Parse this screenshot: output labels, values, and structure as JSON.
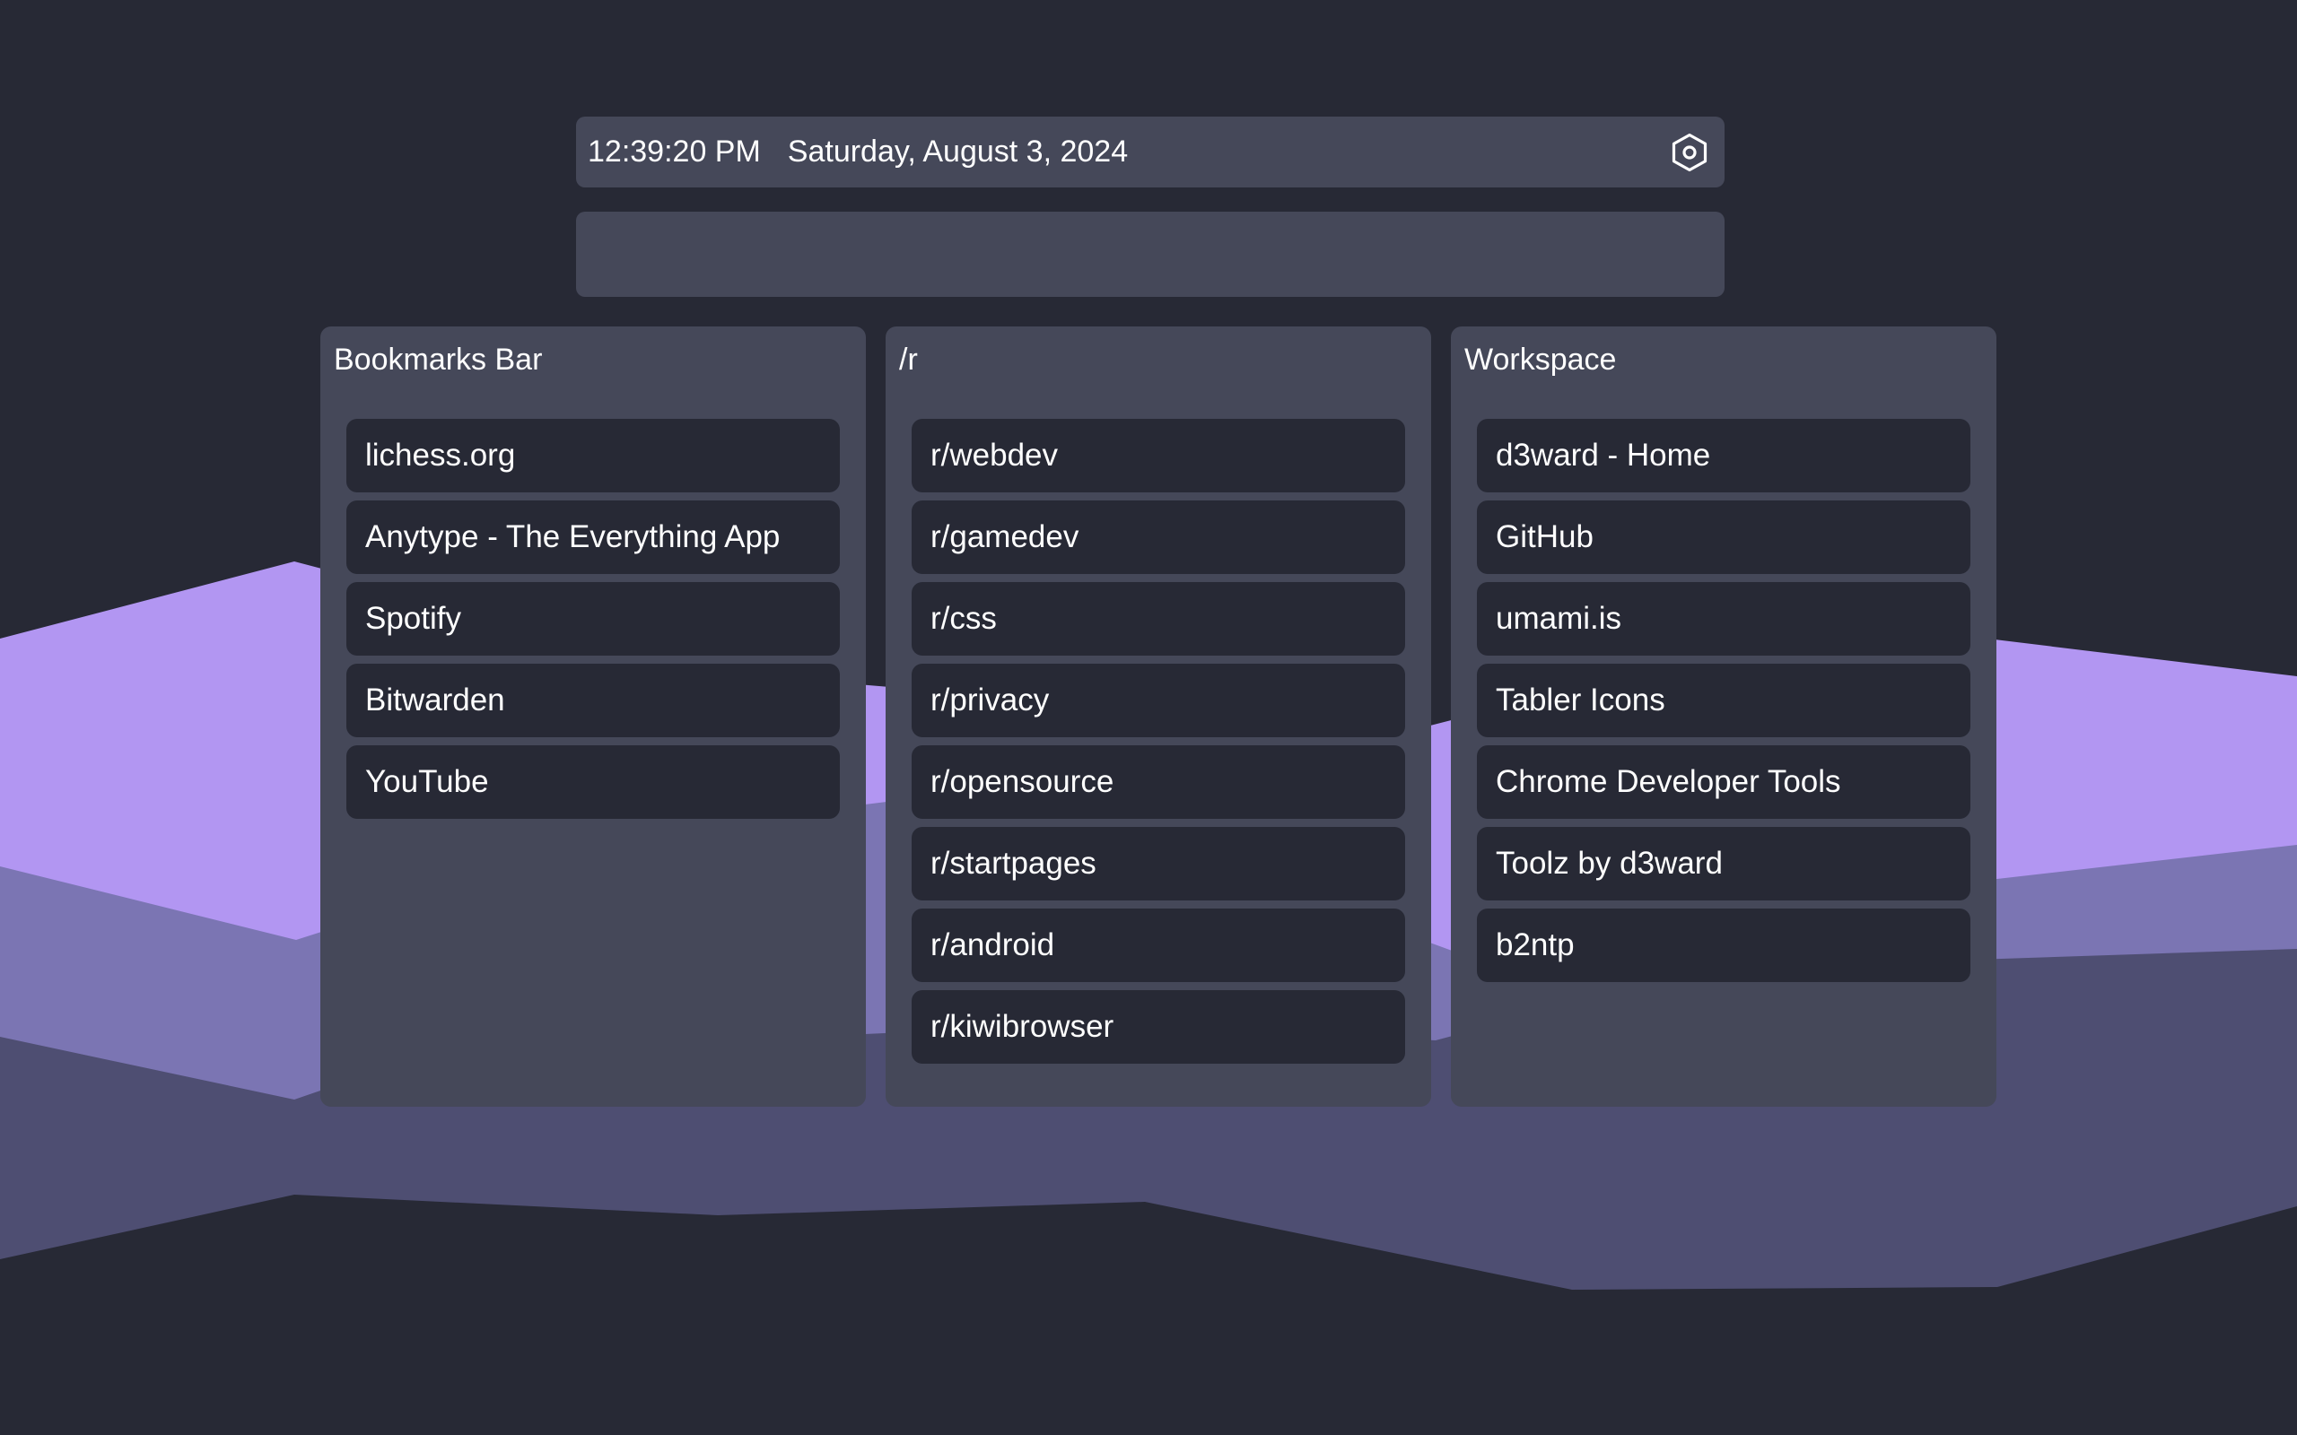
{
  "header": {
    "time": "12:39:20 PM",
    "date": "Saturday, August 3, 2024",
    "settings_icon": "settings-hexagon-icon"
  },
  "search": {
    "value": "",
    "placeholder": ""
  },
  "panels": [
    {
      "title": "Bookmarks Bar",
      "links": [
        "lichess.org",
        "Anytype - The Everything App",
        "Spotify",
        "Bitwarden",
        "YouTube"
      ]
    },
    {
      "title": "/r",
      "links": [
        "r/webdev",
        "r/gamedev",
        "r/css",
        "r/privacy",
        "r/opensource",
        "r/startpages",
        "r/android",
        "r/kiwibrowser"
      ]
    },
    {
      "title": "Workspace",
      "links": [
        "d3ward - Home",
        "GitHub",
        "umami.is",
        "Tabler Icons",
        "Chrome Developer Tools",
        "Toolz by d3ward",
        "b2ntp"
      ]
    }
  ],
  "colors": {
    "background": "#272935",
    "panel": "#454859",
    "link_bg": "#272935",
    "text": "#ffffff",
    "mountain_light": "#b296f2",
    "mountain_mid": "#7b75b3",
    "mountain_dark": "#4e4e72"
  }
}
